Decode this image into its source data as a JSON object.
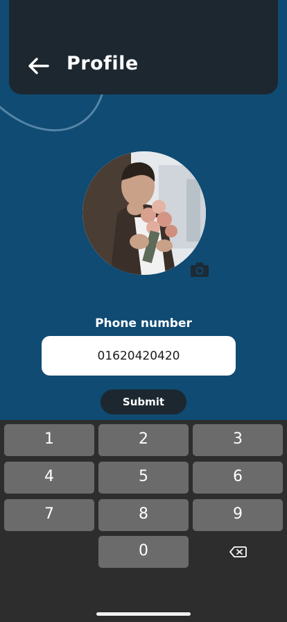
{
  "header": {
    "title": "Profile",
    "back_icon": "arrow-left-icon"
  },
  "profile": {
    "avatar_icon": "profile-photo",
    "camera_icon": "camera-icon"
  },
  "form": {
    "phone_label": "Phone number",
    "phone_value": "01620420420",
    "submit_label": "Submit"
  },
  "keyboard": {
    "keys": [
      "1",
      "2",
      "3",
      "4",
      "5",
      "6",
      "7",
      "8",
      "9",
      "0"
    ],
    "backspace_icon": "backspace-icon"
  },
  "colors": {
    "background": "#0f4b73",
    "header": "#1c272f",
    "keyboard": "#2d2d2d",
    "key": "#6b6b6b"
  }
}
